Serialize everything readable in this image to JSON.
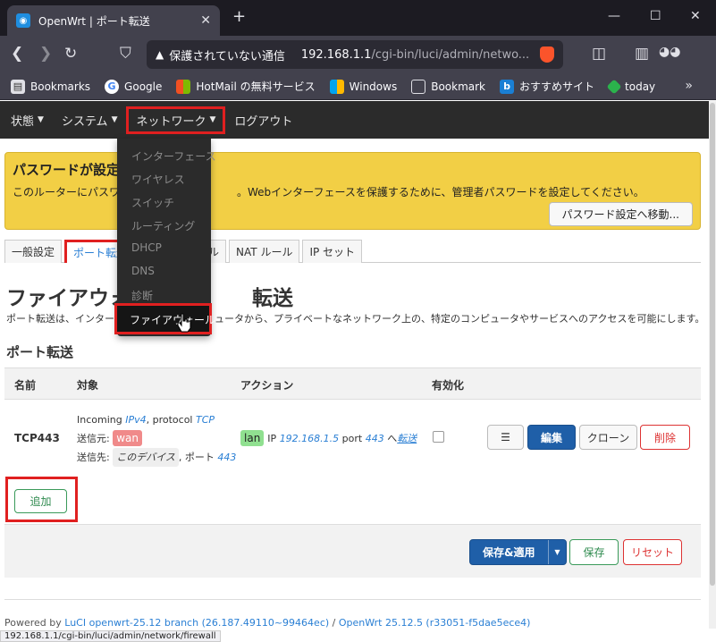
{
  "browser": {
    "tab_title": "OpenWrt | ポート転送",
    "tab_close": "✕",
    "new_tab": "+",
    "security_label": "保護されていない通信",
    "url_host": "192.168.1.1",
    "url_path": "/cgi-bin/luci/admin/netwo...",
    "bookmarks": [
      {
        "label": "Bookmarks",
        "icon": "bookmarks-icon"
      },
      {
        "label": "Google",
        "icon": "google-icon"
      },
      {
        "label": "HotMail の無料サービス",
        "icon": "windows-icon"
      },
      {
        "label": "Windows",
        "icon": "windows-icon"
      },
      {
        "label": "Bookmark",
        "icon": "folder-icon"
      },
      {
        "label": "おすすめサイト",
        "icon": "bing-icon"
      },
      {
        "label": "today",
        "icon": "feedly-icon"
      }
    ],
    "status_url": "192.168.1.1/cgi-bin/luci/admin/network/firewall"
  },
  "nav": {
    "status": "状態",
    "system": "システム",
    "network": "ネットワーク",
    "logout": "ログアウト"
  },
  "dropdown": {
    "items": [
      "インターフェース",
      "ワイヤレス",
      "スイッチ",
      "ルーティング",
      "DHCP",
      "DNS",
      "診断"
    ],
    "active": "ファイアウォール"
  },
  "alert": {
    "title": "パスワードが設定さ",
    "text_left": "このルーターにパスワードが",
    "text_right": "。Webインターフェースを保護するために、管理者パスワードを設定してください。",
    "button": "パスワード設定へ移動..."
  },
  "tabs": {
    "general": "一般設定",
    "port_forward": "ポート転送",
    "partial": "ル",
    "nat": "NAT ルール",
    "ipset": "IP セット"
  },
  "page": {
    "title_left": "ファイアウォー",
    "title_right": "転送",
    "desc_left": "ポート転送は、インターネ",
    "desc_right": "ュータから、プライベートなネットワーク上の、特定のコンピュータやサービスへのアクセスを可能にします。",
    "section_title": "ポート転送"
  },
  "table": {
    "headers": {
      "name": "名前",
      "target": "対象",
      "action": "アクション",
      "enabled": "有効化"
    },
    "row": {
      "name": "TCP443",
      "incoming": "Incoming",
      "ipv": "IPv4",
      "protocol_label": ", protocol",
      "protocol": "TCP",
      "src_label": "送信元:",
      "src_zone": "wan",
      "dst_label": "送信先:",
      "dst_device": "このデバイス",
      "dst_port_label": ", ポート",
      "dst_port": "443",
      "action_zone": "lan",
      "ip_label": "IP",
      "ip": "192.168.1.5",
      "port_label": "port",
      "port": "443",
      "to": "へ",
      "forward": "転送",
      "enabled": false
    },
    "buttons": {
      "menu": "☰",
      "edit": "編集",
      "clone": "クローン",
      "delete": "削除"
    }
  },
  "add_button": "追加",
  "footer_buttons": {
    "save_apply": "保存&適用",
    "save": "保存",
    "reset": "リセット"
  },
  "powered": {
    "prefix": "Powered by ",
    "luci": "LuCI openwrt-25.12 branch (26.187.49110~99464ec)",
    "sep": " / ",
    "openwrt": "OpenWrt 25.12.5 (r33051-f5dae5ece4)"
  },
  "colors": {
    "accent": "#1f5fa8",
    "highlight": "#e02020",
    "alert": "#f2cf45",
    "zone_wan": "#f08a8a",
    "zone_lan": "#90e090"
  }
}
